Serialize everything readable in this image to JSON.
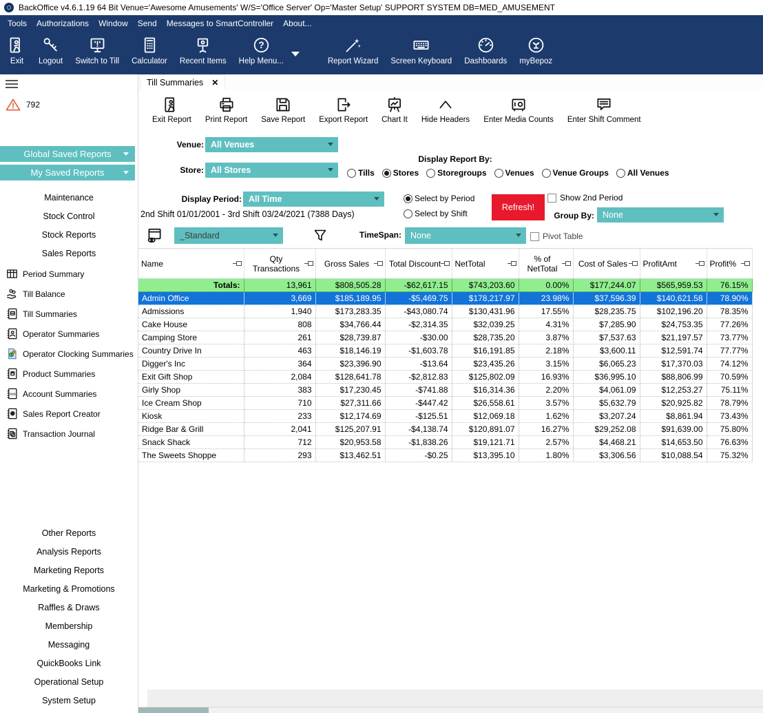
{
  "colors": {
    "navy": "#1c3b6c",
    "teal": "#5fbfc0",
    "refresh_red": "#e8192c",
    "selection_blue": "#1273d8",
    "totals_green": "#90ee90",
    "alert_orange": "#dd5f38"
  },
  "title_bar": {
    "app_title": "BackOffice v4.6.1.19 64 Bit Venue='Awesome Amusements' W/S='Office Server'  Op='Master Setup'  SUPPORT SYSTEM DB=MED_AMUSEMENT"
  },
  "menu_bar": {
    "items": [
      "Tools",
      "Authorizations",
      "Window",
      "Send",
      "Messages to SmartController",
      "About..."
    ]
  },
  "main_toolbar": {
    "items": [
      {
        "label": "Exit",
        "icon": "exit-door-icon"
      },
      {
        "label": "Logout",
        "icon": "key-icon"
      },
      {
        "label": "Switch to Till",
        "icon": "till-monitor-icon"
      },
      {
        "label": "Calculator",
        "icon": "calculator-icon"
      },
      {
        "label": "Recent Items",
        "icon": "recent-items-icon"
      },
      {
        "label": "Help Menu...",
        "icon": "help-icon",
        "has_dropdown": true
      },
      {
        "label": "Report Wizard",
        "icon": "wand-icon"
      },
      {
        "label": "Screen Keyboard",
        "icon": "keyboard-icon"
      },
      {
        "label": "Dashboards",
        "icon": "gauge-icon"
      },
      {
        "label": "myBepoz",
        "icon": "plant-icon"
      }
    ]
  },
  "sidebar": {
    "alert_count": "792",
    "saved_report_buttons": [
      {
        "label": "Global Saved Reports"
      },
      {
        "label": "My Saved Reports"
      }
    ],
    "top_links": [
      "Maintenance",
      "Stock Control",
      "Stock Reports",
      "Sales Reports"
    ],
    "report_items": [
      {
        "label": "Period Summary",
        "icon": "period-summary-icon"
      },
      {
        "label": "Till Balance",
        "icon": "till-balance-icon"
      },
      {
        "label": "Till Summaries",
        "icon": "till-summaries-icon"
      },
      {
        "label": "Operator Summaries",
        "icon": "operator-summaries-icon"
      },
      {
        "label": "Operator Clocking Summaries",
        "icon": "operator-clocking-icon"
      },
      {
        "label": "Product Summaries",
        "icon": "product-summaries-icon"
      },
      {
        "label": "Account Summaries",
        "icon": "account-summaries-icon"
      },
      {
        "label": "Sales Report Creator",
        "icon": "sales-report-creator-icon"
      },
      {
        "label": "Transaction Journal",
        "icon": "transaction-journal-icon"
      }
    ],
    "bottom_links": [
      "Other Reports",
      "Analysis Reports",
      "Marketing Reports",
      "Marketing & Promotions",
      "Raffles & Draws",
      "Membership",
      "Messaging",
      "QuickBooks Link",
      "Operational Setup",
      "System Setup"
    ]
  },
  "tab": {
    "label": "Till Summaries",
    "close_glyph": "✕"
  },
  "report_toolbar": {
    "items": [
      {
        "label": "Exit Report",
        "icon": "exit-door-icon"
      },
      {
        "label": "Print Report",
        "icon": "printer-icon"
      },
      {
        "label": "Save Report",
        "icon": "floppy-icon"
      },
      {
        "label": "Export Report",
        "icon": "export-door-icon"
      },
      {
        "label": "Chart It",
        "icon": "chart-easel-icon"
      },
      {
        "label": "Hide Headers",
        "icon": "chevron-up-icon"
      },
      {
        "label": "Enter Media Counts",
        "icon": "safe-icon"
      },
      {
        "label": "Enter Shift Comment",
        "icon": "comment-icon"
      }
    ]
  },
  "filters": {
    "venue_label": "Venue:",
    "venue_value": "All Venues",
    "store_label": "Store:",
    "store_value": "All Stores",
    "display_report_by": {
      "label": "Display Report By:",
      "options": [
        "Tills",
        "Stores",
        "Storegroups",
        "Venues",
        "Venue Groups",
        "All Venues"
      ],
      "selected": "Stores"
    },
    "display_period_label": "Display Period:",
    "display_period_value": "All Time",
    "period_range": "2nd Shift 01/01/2001 - 3rd Shift 03/24/2021 (7388 Days)",
    "select_by": {
      "options": [
        "Select by Period",
        "Select by Shift"
      ],
      "selected": "Select by Period"
    },
    "refresh_label": "Refresh!",
    "show_2nd_period_label": "Show 2nd Period",
    "show_2nd_period_checked": false,
    "group_by_label": "Group By:",
    "group_by_value": "None",
    "layout_value": "_Standard",
    "timespan_label": "TimeSpan:",
    "timespan_value": "None",
    "pivot_table_label": "Pivot Table",
    "pivot_table_checked": false
  },
  "table": {
    "columns": [
      {
        "label": "Name",
        "align": "left"
      },
      {
        "label": "Qty Transactions",
        "align": "center"
      },
      {
        "label": "Gross Sales",
        "align": "center"
      },
      {
        "label": "Total Discount",
        "align": "center"
      },
      {
        "label": "NetTotal",
        "align": "left"
      },
      {
        "label": "% of NetTotal",
        "align": "center"
      },
      {
        "label": "Cost of Sales",
        "align": "center"
      },
      {
        "label": "ProfitAmt",
        "align": "left"
      },
      {
        "label": "Profit%",
        "align": "left"
      }
    ],
    "totals": [
      "Totals:",
      "13,961",
      "$808,505.28",
      "-$62,617.15",
      "$743,203.60",
      "0.00%",
      "$177,244.07",
      "$565,959.53",
      "76.15%"
    ],
    "rows": [
      [
        "Admin Office",
        "3,669",
        "$185,189.95",
        "-$5,469.75",
        "$178,217.97",
        "23.98%",
        "$37,596.39",
        "$140,621.58",
        "78.90%"
      ],
      [
        "Admissions",
        "1,940",
        "$173,283.35",
        "-$43,080.74",
        "$130,431.96",
        "17.55%",
        "$28,235.75",
        "$102,196.20",
        "78.35%"
      ],
      [
        "Cake House",
        "808",
        "$34,766.44",
        "-$2,314.35",
        "$32,039.25",
        "4.31%",
        "$7,285.90",
        "$24,753.35",
        "77.26%"
      ],
      [
        "Camping Store",
        "261",
        "$28,739.87",
        "-$30.00",
        "$28,735.20",
        "3.87%",
        "$7,537.63",
        "$21,197.57",
        "73.77%"
      ],
      [
        "Country Drive In",
        "463",
        "$18,146.19",
        "-$1,603.78",
        "$16,191.85",
        "2.18%",
        "$3,600.11",
        "$12,591.74",
        "77.77%"
      ],
      [
        "Digger's Inc",
        "364",
        "$23,396.90",
        "-$13.64",
        "$23,435.26",
        "3.15%",
        "$6,065.23",
        "$17,370.03",
        "74.12%"
      ],
      [
        "Exit Gift Shop",
        "2,084",
        "$128,641.78",
        "-$2,812.83",
        "$125,802.09",
        "16.93%",
        "$36,995.10",
        "$88,806.99",
        "70.59%"
      ],
      [
        "Girly Shop",
        "383",
        "$17,230.45",
        "-$741.88",
        "$16,314.36",
        "2.20%",
        "$4,061.09",
        "$12,253.27",
        "75.11%"
      ],
      [
        "Ice Cream Shop",
        "710",
        "$27,311.66",
        "-$447.42",
        "$26,558.61",
        "3.57%",
        "$5,632.79",
        "$20,925.82",
        "78.79%"
      ],
      [
        "Kiosk",
        "233",
        "$12,174.69",
        "-$125.51",
        "$12,069.18",
        "1.62%",
        "$3,207.24",
        "$8,861.94",
        "73.43%"
      ],
      [
        "Ridge Bar & Grill",
        "2,041",
        "$125,207.91",
        "-$4,138.74",
        "$120,891.07",
        "16.27%",
        "$29,252.08",
        "$91,639.00",
        "75.80%"
      ],
      [
        "Snack Shack",
        "712",
        "$20,953.58",
        "-$1,838.26",
        "$19,121.71",
        "2.57%",
        "$4,468.21",
        "$14,653.50",
        "76.63%"
      ],
      [
        "The Sweets Shoppe",
        "293",
        "$13,462.51",
        "-$0.25",
        "$13,395.10",
        "1.80%",
        "$3,306.56",
        "$10,088.54",
        "75.32%"
      ]
    ],
    "selected_row_index": 0
  }
}
